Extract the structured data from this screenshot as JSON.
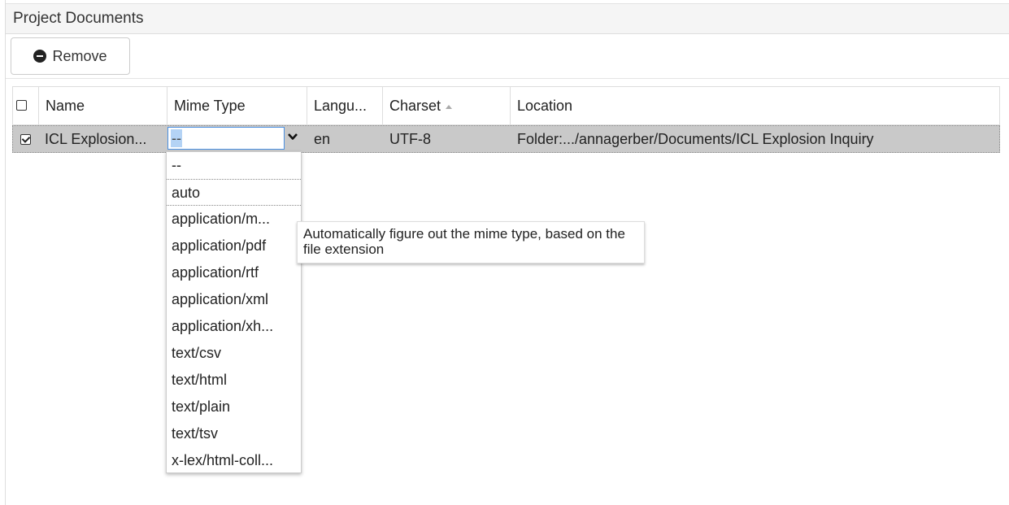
{
  "panel": {
    "title": "Project Documents"
  },
  "toolbar": {
    "remove_label": "Remove",
    "remove_icon": "minus-circle-icon"
  },
  "table": {
    "columns": {
      "name": "Name",
      "mime_type": "Mime Type",
      "language": "Langu...",
      "charset": "Charset",
      "location": "Location"
    },
    "sort_column": "charset",
    "sort_direction": "ascending",
    "rows": [
      {
        "selected": true,
        "name": "ICL Explosion...",
        "mime_type": "--",
        "language": "en",
        "charset": "UTF-8",
        "location": "Folder:.../annagerber/Documents/ICL Explosion Inquiry"
      }
    ]
  },
  "mime_dropdown": {
    "options": [
      "--",
      "auto",
      "application/m...",
      "application/pdf",
      "application/rtf",
      "application/xml",
      "application/xh...",
      "text/csv",
      "text/html",
      "text/plain",
      "text/tsv",
      "x-lex/html-coll..."
    ],
    "highlight_color": "#b4d3f5"
  },
  "tooltip": {
    "text": "Automatically figure out the mime type, based on the file extension"
  },
  "colors": {
    "row_selected_bg": "#c9c9c9",
    "select_focus_border": "#4a90e2"
  }
}
